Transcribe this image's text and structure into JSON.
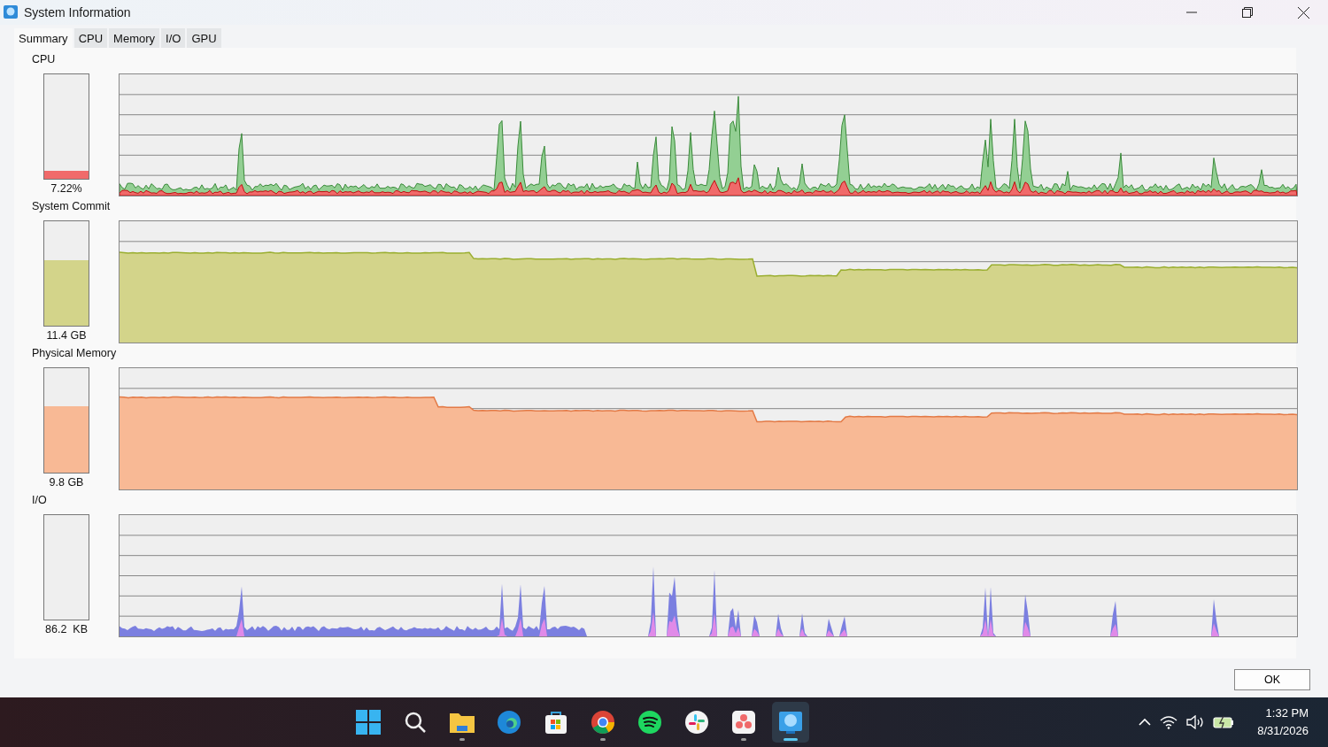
{
  "window": {
    "title": "System Information"
  },
  "tabs": [
    {
      "label": "Summary",
      "selected": true
    },
    {
      "label": "CPU",
      "selected": false
    },
    {
      "label": "Memory",
      "selected": false
    },
    {
      "label": "I/O",
      "selected": false
    },
    {
      "label": "GPU",
      "selected": false
    }
  ],
  "sections": [
    {
      "label": "CPU",
      "kind": "cpu",
      "level": 0.07,
      "reading": "7.22%"
    },
    {
      "label": "System Commit",
      "kind": "commit",
      "level": 0.62,
      "reading": "11.4 GB"
    },
    {
      "label": "Physical Memory",
      "kind": "memory",
      "level": 0.63,
      "reading": "9.8 GB"
    },
    {
      "label": "I/O",
      "kind": "io",
      "level": 0,
      "reading": "86.2  KB"
    }
  ],
  "ok_button": "OK",
  "taskbar": {
    "apps": [
      {
        "kind": "start",
        "running": false,
        "selected": false
      },
      {
        "kind": "search",
        "running": false,
        "selected": false
      },
      {
        "kind": "folder",
        "running": true,
        "selected": false
      },
      {
        "kind": "browser",
        "running": false,
        "selected": false
      },
      {
        "kind": "store",
        "running": false,
        "selected": false
      },
      {
        "kind": "chrome",
        "running": true,
        "selected": false
      },
      {
        "kind": "music",
        "running": false,
        "selected": false
      },
      {
        "kind": "chat",
        "running": false,
        "selected": false
      },
      {
        "kind": "tasks",
        "running": true,
        "selected": false
      },
      {
        "kind": "sysinfo",
        "running": true,
        "selected": true
      }
    ],
    "time": "1:32 PM",
    "date": "8/31/2026"
  }
}
